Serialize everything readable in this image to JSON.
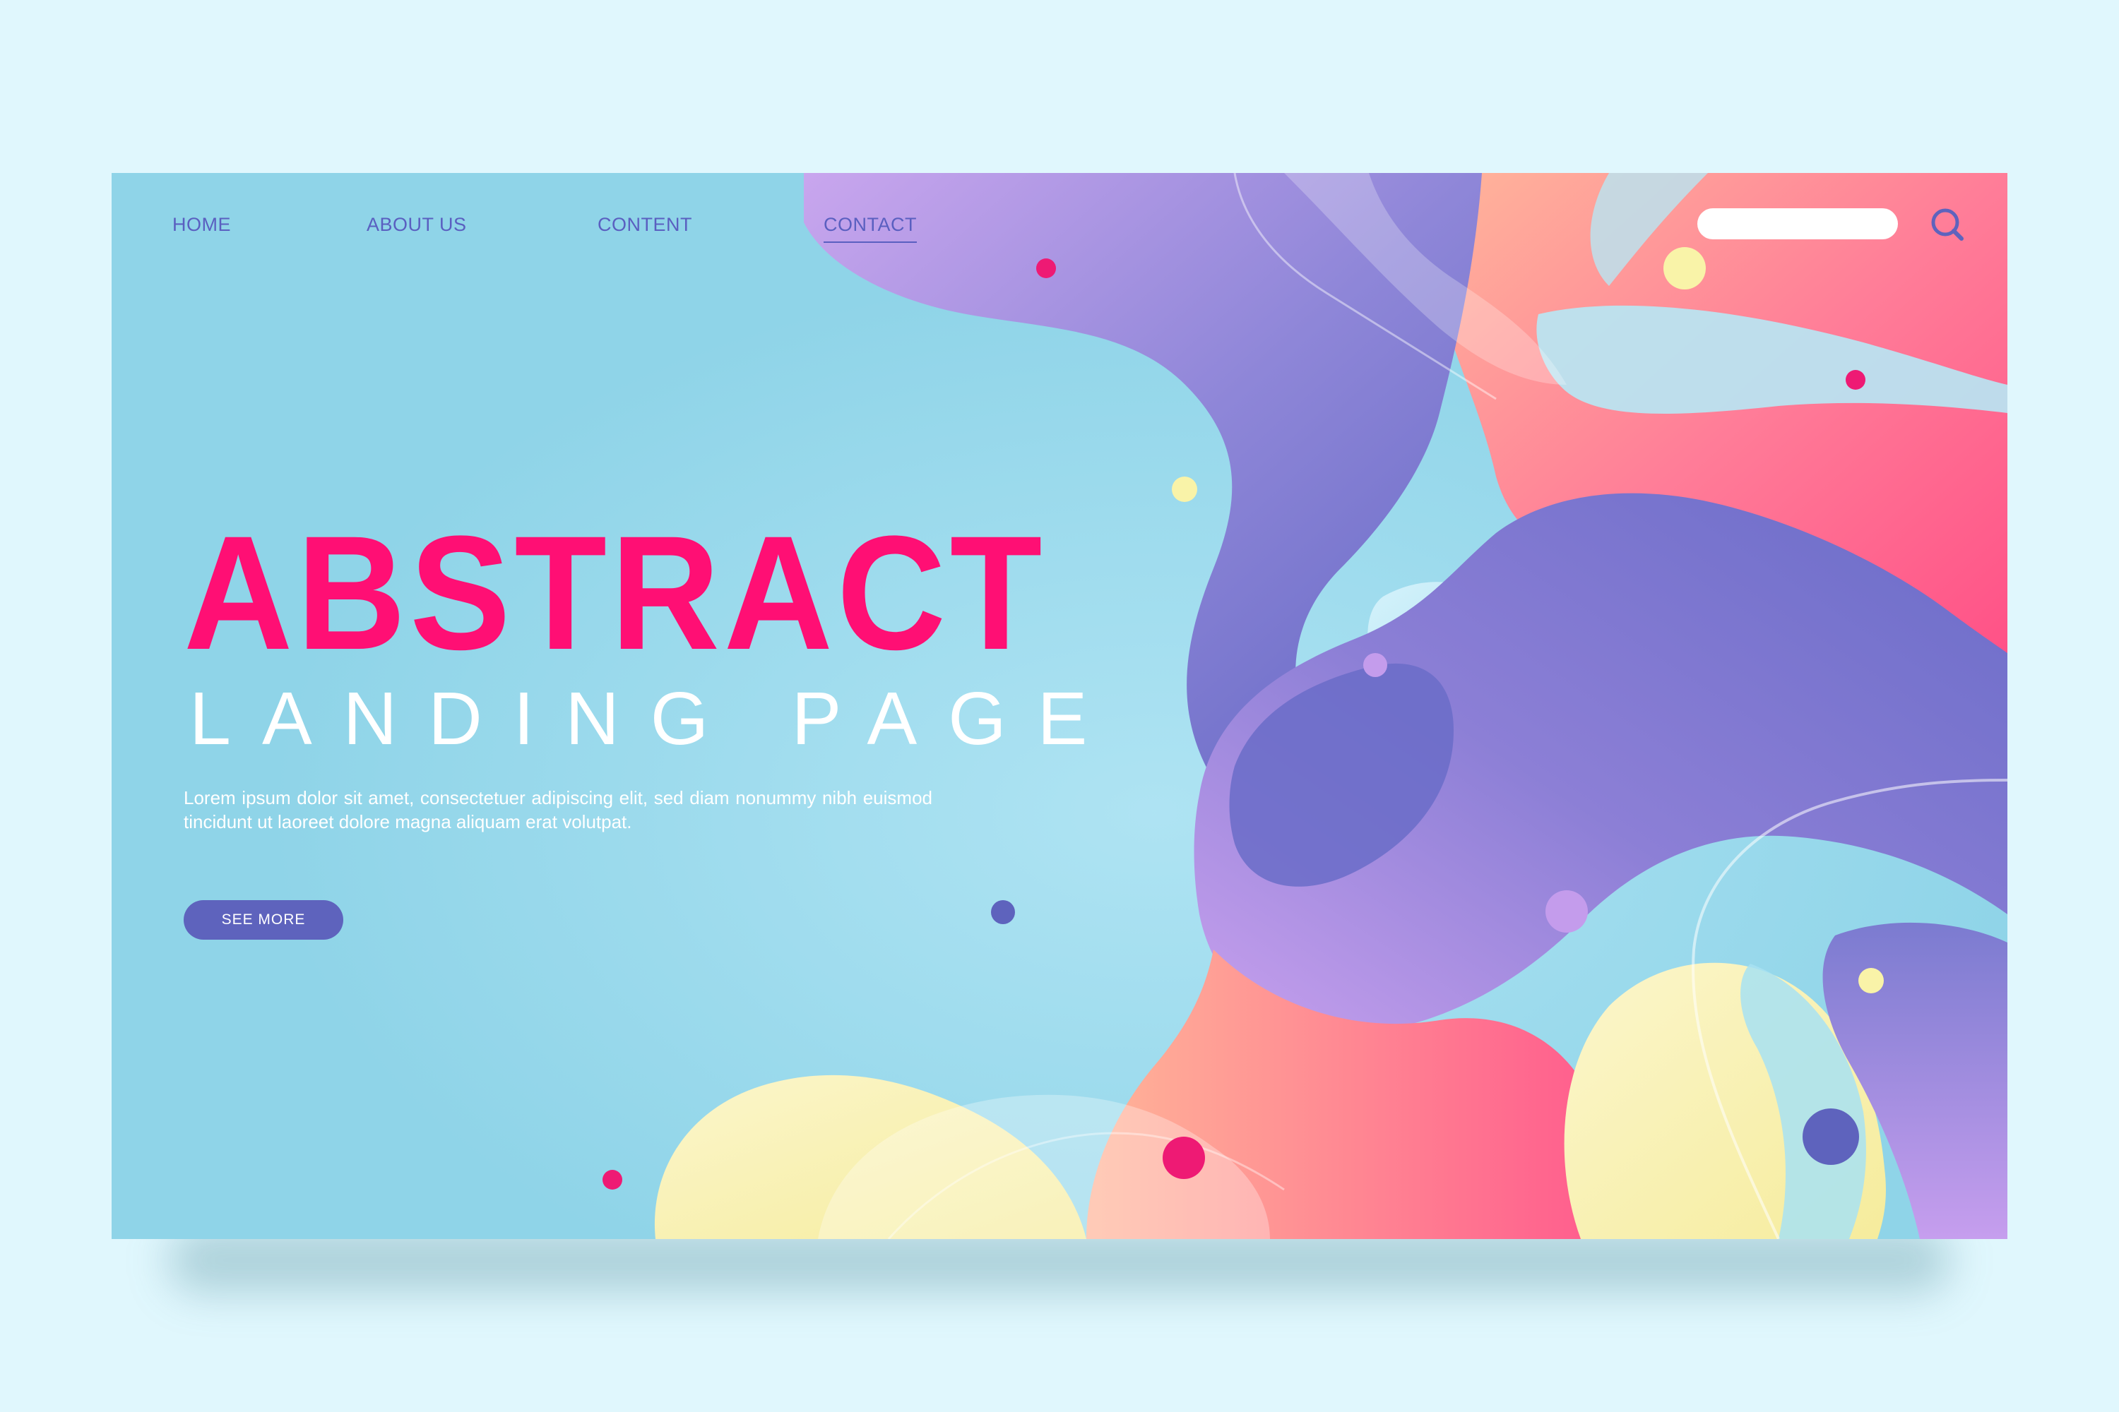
{
  "nav": {
    "items": [
      {
        "label": "HOME",
        "active": false
      },
      {
        "label": "ABOUT US",
        "active": false
      },
      {
        "label": "CONTENT",
        "active": false
      },
      {
        "label": "CONTACT",
        "active": true
      }
    ]
  },
  "search": {
    "placeholder": "",
    "value": "",
    "icon": "search-icon"
  },
  "hero": {
    "title": "ABSTRACT",
    "subtitle": "LANDING PAGE",
    "body": "Lorem ipsum dolor sit amet, consectetuer adipiscing elit, sed diam nonummy nibh euismod tincidunt ut laoreet dolore magna aliquam erat volutpat.",
    "button_label": "SEE MORE"
  },
  "colors": {
    "page_background": "#e0f7fd",
    "hero_background": "#8fd4e8",
    "accent_pink": "#ff0f74",
    "accent_purple": "#5e63bd",
    "lavender": "#c49cec",
    "soft_yellow": "#f8f1b0",
    "coral": "#ff6f8c",
    "text_white": "#ffffff"
  }
}
